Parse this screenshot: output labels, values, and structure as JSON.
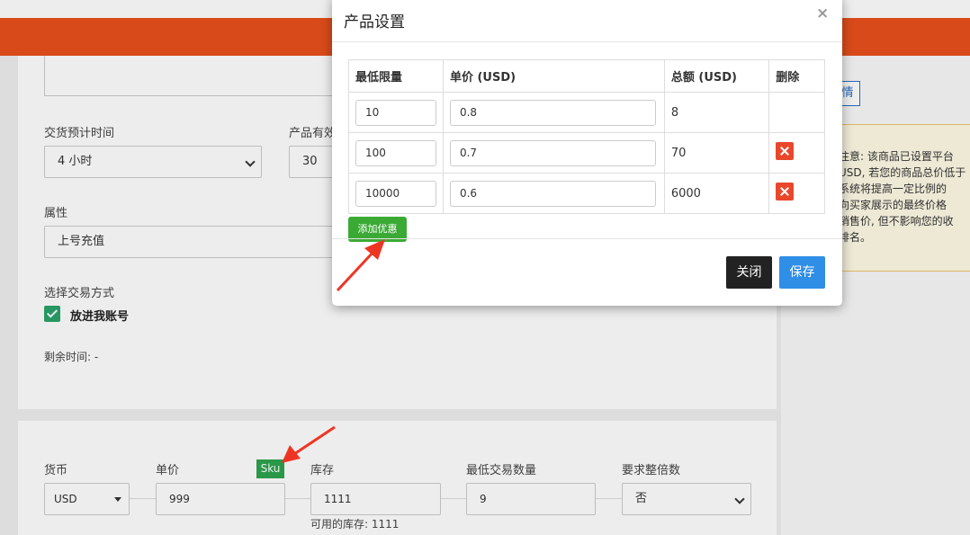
{
  "form": {
    "delivery_time": {
      "label": "交货预计时间",
      "value": "4 小时"
    },
    "validity": {
      "label": "产品有效",
      "value": "30"
    },
    "attribute": {
      "label": "属性",
      "value": "上号充值"
    },
    "trade_method": {
      "label": "选择交易方式",
      "option": "放进我账号",
      "checked": true
    },
    "remaining_time": "剩余时间: -"
  },
  "pricing": {
    "currency": {
      "label": "货币",
      "value": "USD"
    },
    "unit_price": {
      "label": "单价",
      "value": "999",
      "sku_badge": "Sku"
    },
    "stock": {
      "label": "库存",
      "value": "1111",
      "available": "可用的库存: 1111"
    },
    "min_qty": {
      "label": "最低交易数量",
      "value": "9"
    },
    "multiple": {
      "label": "要求整倍数",
      "value": "否"
    }
  },
  "sidebar": {
    "button_label": "情",
    "notice_lines": [
      "注意: 该商品已设置平台",
      "USD, 若您的商品总价低于",
      "系统将提高一定比例的",
      "向买家展示的最终价格",
      "销售价, 但不影响您的收",
      "排名。"
    ]
  },
  "modal": {
    "title": "产品设置",
    "close_icon": "×",
    "columns": [
      "最低限量",
      "单价 (USD)",
      "总额 (USD)",
      "删除"
    ],
    "rows": [
      {
        "min_qty": "10",
        "unit_price": "0.8",
        "total": "8",
        "deletable": false
      },
      {
        "min_qty": "100",
        "unit_price": "0.7",
        "total": "70",
        "deletable": true
      },
      {
        "min_qty": "10000",
        "unit_price": "0.6",
        "total": "6000",
        "deletable": true
      }
    ],
    "add_button": "添加优惠",
    "close_button": "关闭",
    "save_button": "保存"
  },
  "colors": {
    "brand_orange": "#e9501d",
    "check_green": "#29a36a",
    "add_green": "#3aaa35",
    "save_blue": "#2f8ee6",
    "delete_red": "#e8472c",
    "annotation_red": "#ee3524"
  }
}
